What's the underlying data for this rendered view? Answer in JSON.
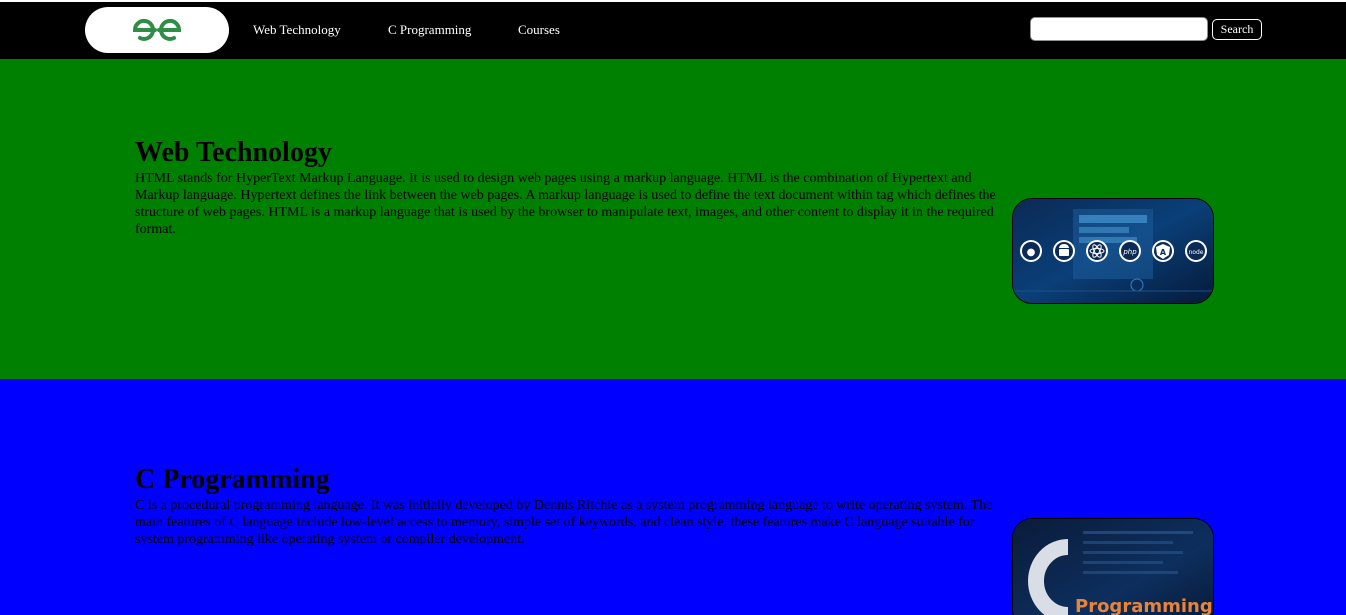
{
  "navbar": {
    "logo_icon": "gfg-logo-icon",
    "links": [
      {
        "label": "Web Technology"
      },
      {
        "label": "C Programming"
      },
      {
        "label": "Courses"
      }
    ],
    "search": {
      "value": "",
      "button_label": "Search"
    }
  },
  "sections": [
    {
      "id": "web-technology",
      "background": "#008000",
      "title": "Web Technology",
      "text": "HTML stands for HyperText Markup Language. It is used to design web pages using a markup language. HTML is the combination of Hypertext and Markup language. Hypertext defines the link between the web pages. A markup language is used to define the text document within tag which defines the structure of web pages. HTML is a markup language that is used by the browser to manipulate text, images, and other content to display it in the required format.",
      "image_icon": "web-technology-banner-image",
      "image_badges": [
        "apple-icon",
        "android-icon",
        "react-icon",
        "php-icon",
        "angular-icon",
        "node-icon"
      ]
    },
    {
      "id": "c-programming",
      "background": "#0000ff",
      "title": "C Programming",
      "text": "C is a procedural programming language. It was initially developed by Dennis Ritchie as a system programming language to write operating system. The main features of C language include low-level access to memory, simple set of keywords, and clean style, these features make C language suitable for system programming like operating system or compiler development.",
      "image_icon": "c-programming-banner-image",
      "image_text": "Programming"
    }
  ],
  "colors": {
    "navbar_bg": "#000000",
    "nav_text": "#ffffff",
    "logo_green": "#2f8d46"
  }
}
